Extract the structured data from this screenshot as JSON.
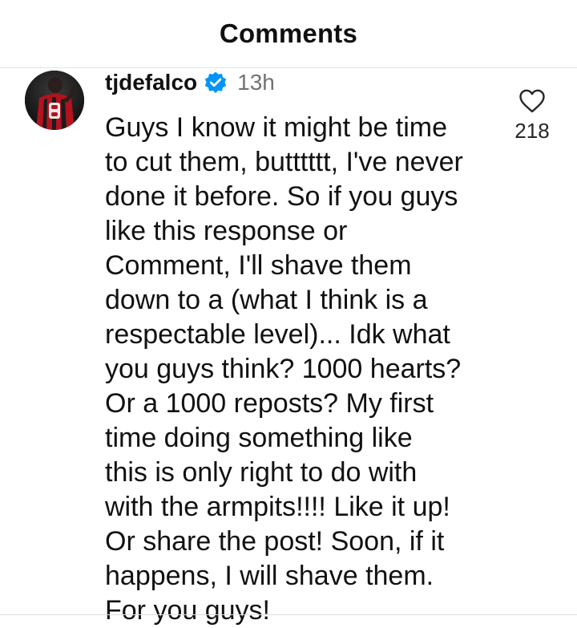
{
  "header": {
    "title": "Comments"
  },
  "comment": {
    "username": "tjdefalco",
    "verified_icon": "verified-badge-icon",
    "time": "13h",
    "text": "Guys I know it might be time\nto cut them, butttttt, I've never\ndone it before. So if you guys\nlike this response or\nComment, I'll shave them\ndown to a (what I think is a\nrespectable level)... Idk what\nyou guys think? 1000 hearts?\nOr a 1000 reposts? My first\ntime doing something like\nthis is only right to do with\nwith the armpits!!!! Like it up!\nOr share the post! Soon, if it\nhappens, I will shave them.\nFor you guys!",
    "like_icon": "heart-outline-icon",
    "like_count": "218"
  },
  "colors": {
    "verified_blue": "#0095f6",
    "muted_text": "#737373",
    "text": "#111111"
  }
}
